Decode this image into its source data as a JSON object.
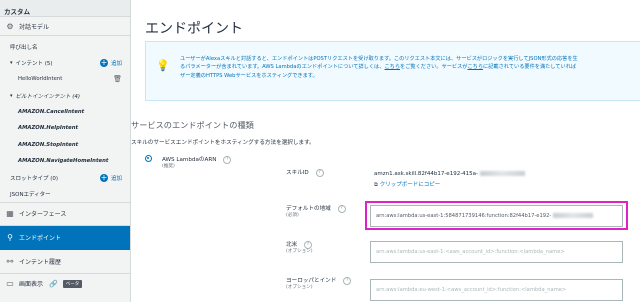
{
  "sidebar": {
    "header": "カスタム",
    "model": "対話モデル",
    "invocation": "呼び出し名",
    "intents": "インテント (5)",
    "add": "追加",
    "custom_intent": "HelloWorldIntent",
    "builtin_intents": "ビルトインインテント (4)",
    "builtins": [
      "AMAZON.CancelIntent",
      "AMAZON.HelpIntent",
      "AMAZON.StopIntent",
      "AMAZON.NavigateHomeIntent"
    ],
    "slot_types": "スロットタイプ (0)",
    "json_editor": "JSONエディター",
    "interfaces": "インターフェース",
    "endpoint": "エンドポイント",
    "intent_history": "インテント履歴",
    "display": "画面表示",
    "beta": "ベータ"
  },
  "main": {
    "title": "エンドポイント",
    "info_l1": "ユーザーがAlexaスキルと対話すると、エンドポイントはPOSTリクエストを受け取ります。このリクエスト本文には、サービスがロジックを実行してJSON形式の応答を生",
    "info_l2_a": "るパラメーターが含まれています。AWS Lambdaのエンドポイントについて詳しくは、",
    "info_link1": "こちら",
    "info_l2_b": "をご覧ください。サービスが",
    "info_link2": "こちら",
    "info_l2_c": "に記載されている要件を満たしていれば",
    "info_l3": "ザー定義のHTTPS Webサービスをホスティングできます。",
    "section_title": "サービスのエンドポイントの種類",
    "section_desc": "スキルのサービスエンドポイントをホスティングする方法を選択します。",
    "radio_label": "AWS LambdaのARN",
    "radio_sub": "(推奨)",
    "help_glyph": "?",
    "skill_id_label": "スキルID",
    "skill_id_value": "amzn1.ask.skill.82f44b17-e192-415a-",
    "copy_label": "クリップボードにコピー",
    "default_region_label": "デフォルトの地域",
    "required": "(必須)",
    "default_arn": "arn:aws:lambda:us-east-1:584871739146:function:82f44b17-e192-",
    "na_label": "北米",
    "optional": "(オプション)",
    "na_placeholder": "arn:aws:lambda:us-east-1:<aws_account_id>:function:<lambda_name>",
    "eu_label": "ヨーロッパとインド",
    "eu_placeholder": "arn:aws:lambda:eu-west-1:<aws_account_id>:function:<lambda_name>"
  }
}
